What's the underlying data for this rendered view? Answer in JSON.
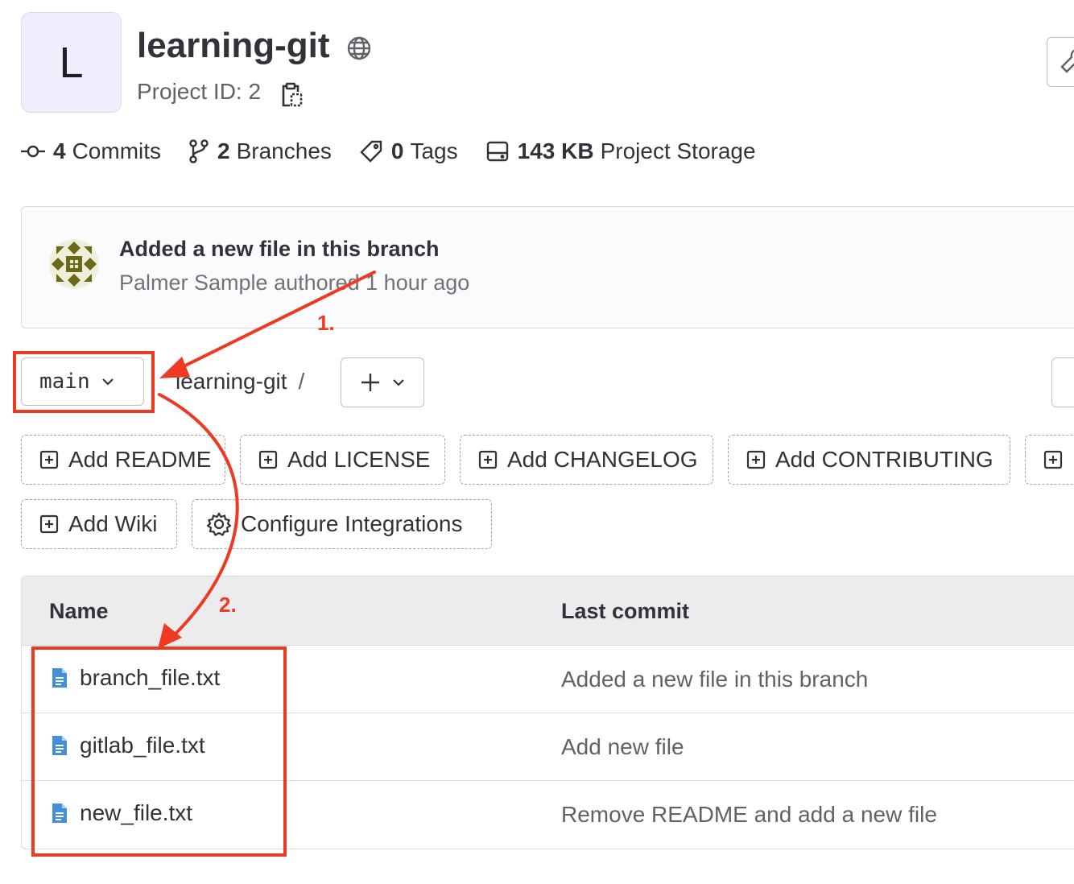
{
  "project": {
    "avatar_letter": "L",
    "name": "learning-git",
    "visibility_icon": "globe-icon",
    "id_label": "Project ID: 2"
  },
  "stats": [
    {
      "icon": "commit-icon",
      "count": "4",
      "label": "Commits"
    },
    {
      "icon": "branch-icon",
      "count": "2",
      "label": "Branches"
    },
    {
      "icon": "tag-icon",
      "count": "0",
      "label": "Tags"
    },
    {
      "icon": "storage-icon",
      "count": "143 KB",
      "label": "Project Storage"
    }
  ],
  "last_commit": {
    "title": "Added a new file in this branch",
    "meta": "Palmer Sample authored 1 hour ago"
  },
  "branch_selector": {
    "value": "main"
  },
  "breadcrumb": {
    "repo": "learning-git",
    "separator": "/"
  },
  "quick_actions": [
    {
      "label": "Add README",
      "icon": "plus-square-icon"
    },
    {
      "label": "Add LICENSE",
      "icon": "plus-square-icon"
    },
    {
      "label": "Add CHANGELOG",
      "icon": "plus-square-icon"
    },
    {
      "label": "Add CONTRIBUTING",
      "icon": "plus-square-icon"
    },
    {
      "label": "Add Wiki",
      "icon": "plus-square-icon"
    },
    {
      "label": "Configure Integrations",
      "icon": "settings-icon"
    }
  ],
  "file_table": {
    "columns": [
      "Name",
      "Last commit"
    ],
    "rows": [
      {
        "name": "branch_file.txt",
        "last_commit": "Added a new file in this branch"
      },
      {
        "name": "gitlab_file.txt",
        "last_commit": "Add new file"
      },
      {
        "name": "new_file.txt",
        "last_commit": "Remove README and add a new file"
      }
    ]
  },
  "annotations": {
    "step1": "1.",
    "step2": "2.",
    "color": "#ee3a22"
  },
  "colors": {
    "file_icon": "#428fdc",
    "annotation": "#ee3a22"
  }
}
